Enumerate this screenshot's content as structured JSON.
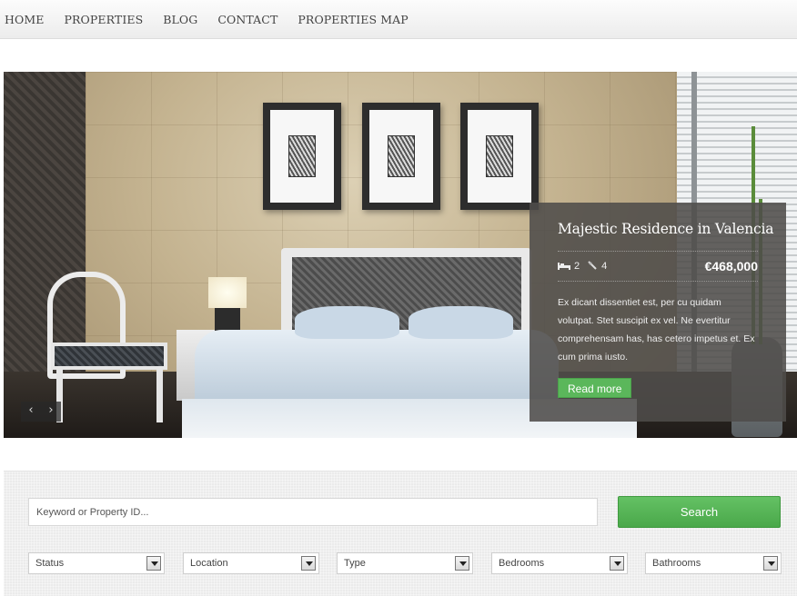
{
  "nav": {
    "items": [
      "HOME",
      "PROPERTIES",
      "BLOG",
      "CONTACT",
      "PROPERTIES MAP"
    ]
  },
  "slider": {
    "prev_label": "‹",
    "next_label": "›"
  },
  "featured": {
    "title": "Majestic Residence in Valencia",
    "bedrooms": "2",
    "bathrooms": "4",
    "bed_icon": "bed-icon",
    "bath_icon": "bath-icon",
    "price": "€468,000",
    "description": "Ex dicant dissentiet est, per cu quidam volutpat. Stet suscipit ex vel. Ne evertitur comprehensam has, has cetero impetus et. Ex cum prima iusto.",
    "read_more": "Read more"
  },
  "search": {
    "keyword_placeholder": "Keyword or Property ID...",
    "button_label": "Search",
    "filters": [
      "Status",
      "Location",
      "Type",
      "Bedrooms",
      "Bathrooms"
    ]
  },
  "colors": {
    "accent_green": "#5bb75b",
    "caption_bg": "#4e4c4a",
    "nav_text": "#444444"
  }
}
